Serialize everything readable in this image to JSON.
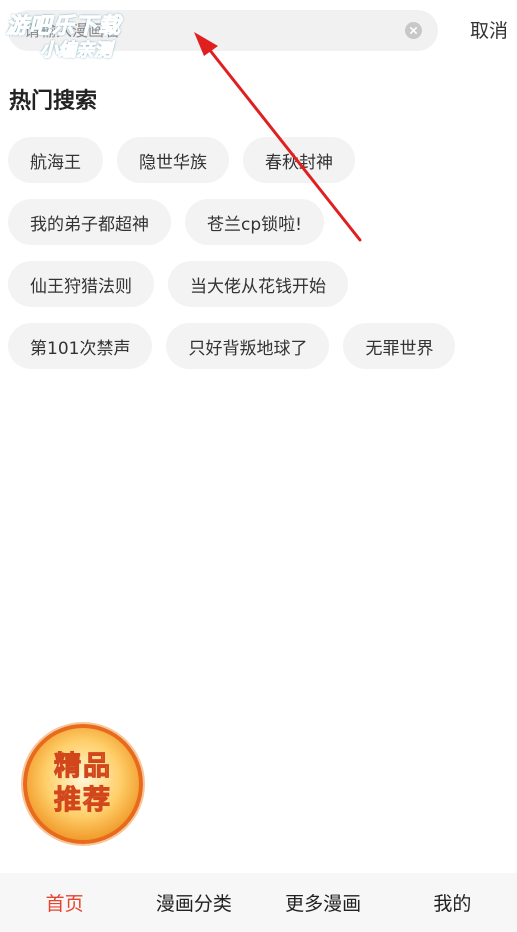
{
  "search": {
    "placeholder": "请输入漫画名",
    "cancel_label": "取消"
  },
  "watermark": {
    "line1": "游吧乐下载",
    "line2": "小编亲测"
  },
  "hot_search": {
    "title": "热门搜索",
    "rows": [
      [
        "航海王",
        "隐世华族",
        "春秋封神"
      ],
      [
        "我的弟子都超神",
        "苍兰cp锁啦!"
      ],
      [
        "仙王狩猎法则",
        "当大佬从花钱开始"
      ],
      [
        "第101次禁声",
        "只好背叛地球了",
        "无罪世界"
      ]
    ]
  },
  "badge": {
    "line1": "精品",
    "line2": "推荐"
  },
  "tabbar": {
    "items": [
      "首页",
      "漫画分类",
      "更多漫画",
      "我的"
    ],
    "active_color": "#e8432e"
  },
  "colors": {
    "arrow": "#e02020"
  }
}
